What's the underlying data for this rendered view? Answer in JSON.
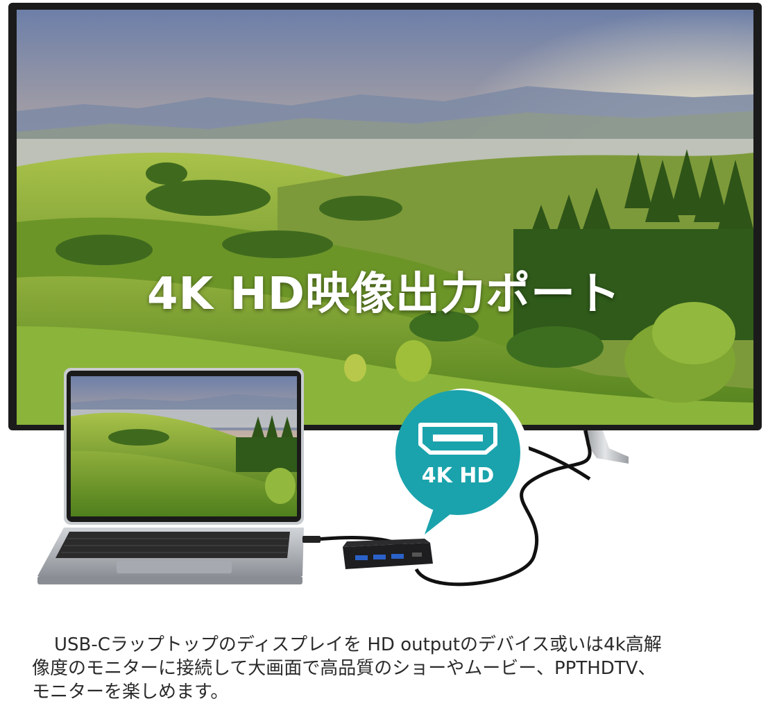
{
  "headline": "4K HD映像出力ポート",
  "badge": {
    "label": "4K HD",
    "icon": "hdmi-port-icon",
    "color": "#1aa3ac"
  },
  "caption": {
    "line1": "USB-Cラップトップのディスプレイを HD outputのデバイス或いは4k高解",
    "line2": "像度のモニターに接続して大画面で高品質のショーやムービー、PPTHDTV、",
    "line3": "モニターを楽しめます。"
  },
  "colors": {
    "teal": "#1aa3ac",
    "tv_frame": "#1b1b1b",
    "laptop_body": "#b8bcc2"
  }
}
